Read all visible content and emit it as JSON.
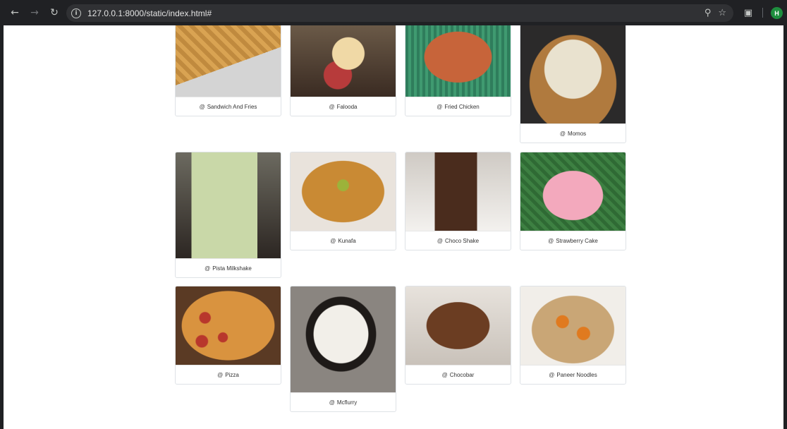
{
  "browser": {
    "url": "127.0.0.1:8000/static/index.html#",
    "profile_initial": "H"
  },
  "gallery": {
    "items": [
      {
        "label": "Sandwich And Fries",
        "icon": "at-icon"
      },
      {
        "label": "Falooda",
        "icon": "at-icon"
      },
      {
        "label": "Fried Chicken",
        "icon": "at-icon"
      },
      {
        "label": "Momos",
        "icon": "at-icon"
      },
      {
        "label": "Pista Milkshake",
        "icon": "at-icon"
      },
      {
        "label": "Kunafa",
        "icon": "at-icon"
      },
      {
        "label": "Choco Shake",
        "icon": "at-icon"
      },
      {
        "label": "Strawberry Cake",
        "icon": "at-icon"
      },
      {
        "label": "Pizza",
        "icon": "at-icon"
      },
      {
        "label": "Mcflurry",
        "icon": "at-icon"
      },
      {
        "label": "Chocobar",
        "icon": "at-icon"
      },
      {
        "label": "Paneer Noodles",
        "icon": "at-icon"
      }
    ]
  },
  "colors": {
    "chrome_bg": "#202124",
    "omnibox_bg": "#303134",
    "avatar_bg": "#1e8e3e",
    "card_border": "#dee2e6"
  }
}
